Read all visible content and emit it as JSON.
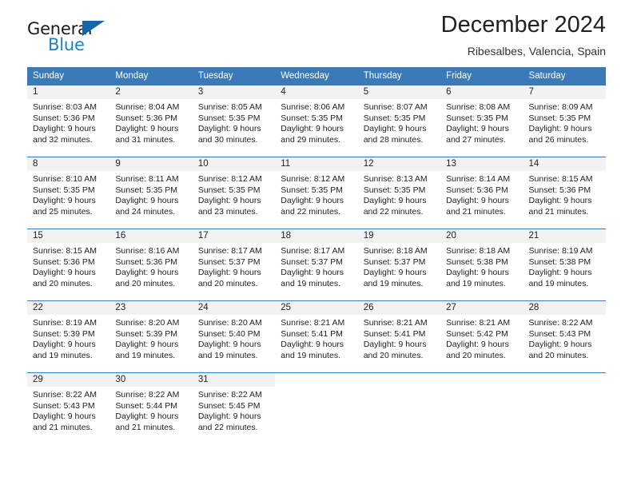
{
  "brand": {
    "name_part1": "General",
    "name_part2": "Blue",
    "triangle_color": "#1166ad",
    "blue_text_color": "#1f7fc4"
  },
  "header": {
    "title": "December 2024",
    "subtitle": "Ribesalbes, Valencia, Spain"
  },
  "theme": {
    "header_blue": "#3a7ab8",
    "daynum_band": "#f2f2f2",
    "text": "#222222"
  },
  "weekday_headers": [
    "Sunday",
    "Monday",
    "Tuesday",
    "Wednesday",
    "Thursday",
    "Friday",
    "Saturday"
  ],
  "weeks": [
    [
      {
        "day": "1",
        "sunrise": "Sunrise: 8:03 AM",
        "sunset": "Sunset: 5:36 PM",
        "daylight_line1": "Daylight: 9 hours",
        "daylight_line2": "and 32 minutes."
      },
      {
        "day": "2",
        "sunrise": "Sunrise: 8:04 AM",
        "sunset": "Sunset: 5:36 PM",
        "daylight_line1": "Daylight: 9 hours",
        "daylight_line2": "and 31 minutes."
      },
      {
        "day": "3",
        "sunrise": "Sunrise: 8:05 AM",
        "sunset": "Sunset: 5:35 PM",
        "daylight_line1": "Daylight: 9 hours",
        "daylight_line2": "and 30 minutes."
      },
      {
        "day": "4",
        "sunrise": "Sunrise: 8:06 AM",
        "sunset": "Sunset: 5:35 PM",
        "daylight_line1": "Daylight: 9 hours",
        "daylight_line2": "and 29 minutes."
      },
      {
        "day": "5",
        "sunrise": "Sunrise: 8:07 AM",
        "sunset": "Sunset: 5:35 PM",
        "daylight_line1": "Daylight: 9 hours",
        "daylight_line2": "and 28 minutes."
      },
      {
        "day": "6",
        "sunrise": "Sunrise: 8:08 AM",
        "sunset": "Sunset: 5:35 PM",
        "daylight_line1": "Daylight: 9 hours",
        "daylight_line2": "and 27 minutes."
      },
      {
        "day": "7",
        "sunrise": "Sunrise: 8:09 AM",
        "sunset": "Sunset: 5:35 PM",
        "daylight_line1": "Daylight: 9 hours",
        "daylight_line2": "and 26 minutes."
      }
    ],
    [
      {
        "day": "8",
        "sunrise": "Sunrise: 8:10 AM",
        "sunset": "Sunset: 5:35 PM",
        "daylight_line1": "Daylight: 9 hours",
        "daylight_line2": "and 25 minutes."
      },
      {
        "day": "9",
        "sunrise": "Sunrise: 8:11 AM",
        "sunset": "Sunset: 5:35 PM",
        "daylight_line1": "Daylight: 9 hours",
        "daylight_line2": "and 24 minutes."
      },
      {
        "day": "10",
        "sunrise": "Sunrise: 8:12 AM",
        "sunset": "Sunset: 5:35 PM",
        "daylight_line1": "Daylight: 9 hours",
        "daylight_line2": "and 23 minutes."
      },
      {
        "day": "11",
        "sunrise": "Sunrise: 8:12 AM",
        "sunset": "Sunset: 5:35 PM",
        "daylight_line1": "Daylight: 9 hours",
        "daylight_line2": "and 22 minutes."
      },
      {
        "day": "12",
        "sunrise": "Sunrise: 8:13 AM",
        "sunset": "Sunset: 5:35 PM",
        "daylight_line1": "Daylight: 9 hours",
        "daylight_line2": "and 22 minutes."
      },
      {
        "day": "13",
        "sunrise": "Sunrise: 8:14 AM",
        "sunset": "Sunset: 5:36 PM",
        "daylight_line1": "Daylight: 9 hours",
        "daylight_line2": "and 21 minutes."
      },
      {
        "day": "14",
        "sunrise": "Sunrise: 8:15 AM",
        "sunset": "Sunset: 5:36 PM",
        "daylight_line1": "Daylight: 9 hours",
        "daylight_line2": "and 21 minutes."
      }
    ],
    [
      {
        "day": "15",
        "sunrise": "Sunrise: 8:15 AM",
        "sunset": "Sunset: 5:36 PM",
        "daylight_line1": "Daylight: 9 hours",
        "daylight_line2": "and 20 minutes."
      },
      {
        "day": "16",
        "sunrise": "Sunrise: 8:16 AM",
        "sunset": "Sunset: 5:36 PM",
        "daylight_line1": "Daylight: 9 hours",
        "daylight_line2": "and 20 minutes."
      },
      {
        "day": "17",
        "sunrise": "Sunrise: 8:17 AM",
        "sunset": "Sunset: 5:37 PM",
        "daylight_line1": "Daylight: 9 hours",
        "daylight_line2": "and 20 minutes."
      },
      {
        "day": "18",
        "sunrise": "Sunrise: 8:17 AM",
        "sunset": "Sunset: 5:37 PM",
        "daylight_line1": "Daylight: 9 hours",
        "daylight_line2": "and 19 minutes."
      },
      {
        "day": "19",
        "sunrise": "Sunrise: 8:18 AM",
        "sunset": "Sunset: 5:37 PM",
        "daylight_line1": "Daylight: 9 hours",
        "daylight_line2": "and 19 minutes."
      },
      {
        "day": "20",
        "sunrise": "Sunrise: 8:18 AM",
        "sunset": "Sunset: 5:38 PM",
        "daylight_line1": "Daylight: 9 hours",
        "daylight_line2": "and 19 minutes."
      },
      {
        "day": "21",
        "sunrise": "Sunrise: 8:19 AM",
        "sunset": "Sunset: 5:38 PM",
        "daylight_line1": "Daylight: 9 hours",
        "daylight_line2": "and 19 minutes."
      }
    ],
    [
      {
        "day": "22",
        "sunrise": "Sunrise: 8:19 AM",
        "sunset": "Sunset: 5:39 PM",
        "daylight_line1": "Daylight: 9 hours",
        "daylight_line2": "and 19 minutes."
      },
      {
        "day": "23",
        "sunrise": "Sunrise: 8:20 AM",
        "sunset": "Sunset: 5:39 PM",
        "daylight_line1": "Daylight: 9 hours",
        "daylight_line2": "and 19 minutes."
      },
      {
        "day": "24",
        "sunrise": "Sunrise: 8:20 AM",
        "sunset": "Sunset: 5:40 PM",
        "daylight_line1": "Daylight: 9 hours",
        "daylight_line2": "and 19 minutes."
      },
      {
        "day": "25",
        "sunrise": "Sunrise: 8:21 AM",
        "sunset": "Sunset: 5:41 PM",
        "daylight_line1": "Daylight: 9 hours",
        "daylight_line2": "and 19 minutes."
      },
      {
        "day": "26",
        "sunrise": "Sunrise: 8:21 AM",
        "sunset": "Sunset: 5:41 PM",
        "daylight_line1": "Daylight: 9 hours",
        "daylight_line2": "and 20 minutes."
      },
      {
        "day": "27",
        "sunrise": "Sunrise: 8:21 AM",
        "sunset": "Sunset: 5:42 PM",
        "daylight_line1": "Daylight: 9 hours",
        "daylight_line2": "and 20 minutes."
      },
      {
        "day": "28",
        "sunrise": "Sunrise: 8:22 AM",
        "sunset": "Sunset: 5:43 PM",
        "daylight_line1": "Daylight: 9 hours",
        "daylight_line2": "and 20 minutes."
      }
    ],
    [
      {
        "day": "29",
        "sunrise": "Sunrise: 8:22 AM",
        "sunset": "Sunset: 5:43 PM",
        "daylight_line1": "Daylight: 9 hours",
        "daylight_line2": "and 21 minutes."
      },
      {
        "day": "30",
        "sunrise": "Sunrise: 8:22 AM",
        "sunset": "Sunset: 5:44 PM",
        "daylight_line1": "Daylight: 9 hours",
        "daylight_line2": "and 21 minutes."
      },
      {
        "day": "31",
        "sunrise": "Sunrise: 8:22 AM",
        "sunset": "Sunset: 5:45 PM",
        "daylight_line1": "Daylight: 9 hours",
        "daylight_line2": "and 22 minutes."
      },
      {
        "day": "",
        "sunrise": "",
        "sunset": "",
        "daylight_line1": "",
        "daylight_line2": ""
      },
      {
        "day": "",
        "sunrise": "",
        "sunset": "",
        "daylight_line1": "",
        "daylight_line2": ""
      },
      {
        "day": "",
        "sunrise": "",
        "sunset": "",
        "daylight_line1": "",
        "daylight_line2": ""
      },
      {
        "day": "",
        "sunrise": "",
        "sunset": "",
        "daylight_line1": "",
        "daylight_line2": ""
      }
    ]
  ]
}
